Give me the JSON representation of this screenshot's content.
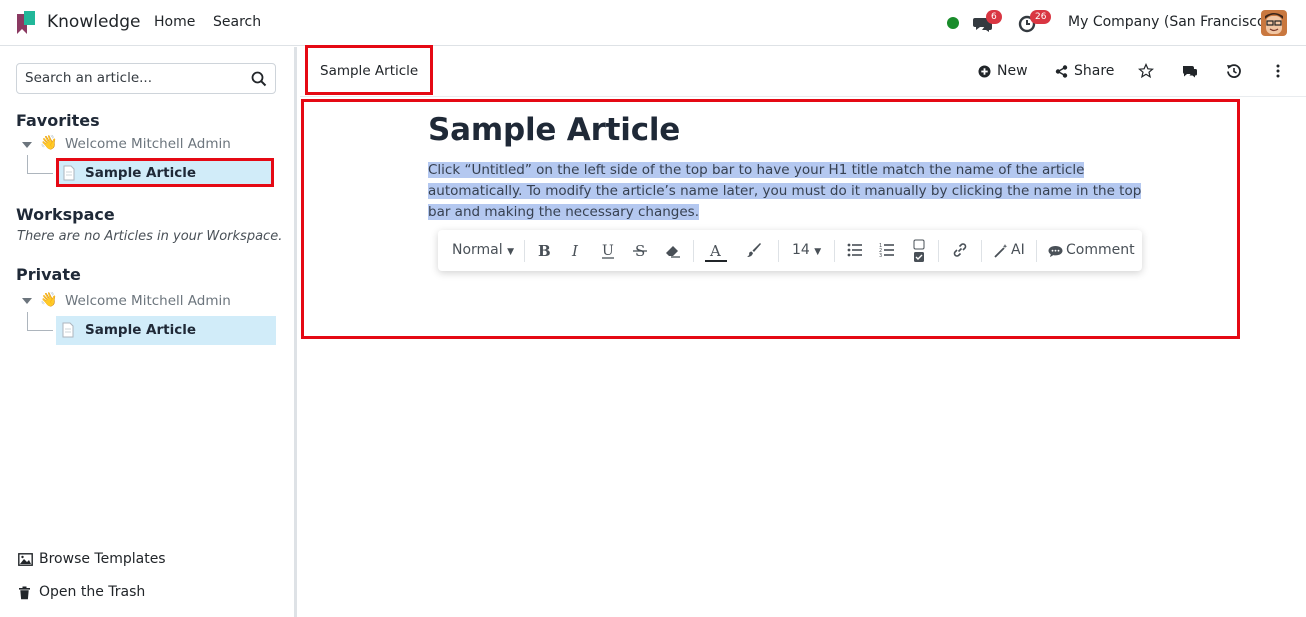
{
  "navbar": {
    "app_name": "Knowledge",
    "links": [
      "Home",
      "Search"
    ],
    "chat_badge": "6",
    "activity_badge": "26",
    "company": "My Company (San Francisco)",
    "status_color": "#198c2b"
  },
  "sidebar": {
    "search_placeholder": "Search an article...",
    "favorites": {
      "title": "Favorites",
      "parent": {
        "emoji": "👋",
        "label": "Welcome Mitchell Admin"
      },
      "child": {
        "label": "Sample Article"
      }
    },
    "workspace": {
      "title": "Workspace",
      "empty_text": "There are no Articles in your Workspace."
    },
    "private": {
      "title": "Private",
      "parent": {
        "emoji": "👋",
        "label": "Welcome Mitchell Admin"
      },
      "child": {
        "label": "Sample Article"
      }
    },
    "footer": {
      "templates": "Browse Templates",
      "trash": "Open the Trash"
    }
  },
  "header": {
    "breadcrumb": "Sample Article",
    "new_label": "New",
    "share_label": "Share"
  },
  "article": {
    "title": "Sample Article",
    "body": "Click “Untitled” on the left side of the top bar to have your H1 title match the name of the article automatically. To modify the article’s name later, you must do it manually by clicking the name in the top bar and making the necessary changes."
  },
  "toolbar": {
    "style": "Normal",
    "font_size": "14",
    "ai_label": "AI",
    "comment_label": "Comment"
  },
  "colors": {
    "highlight_red": "#e50914",
    "selection": "#b4c8f0",
    "active_item": "#d1ecf9",
    "badge": "#d93642"
  }
}
